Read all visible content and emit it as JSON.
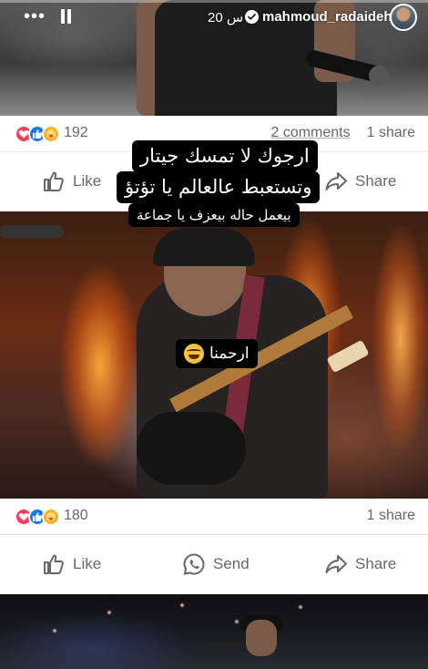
{
  "story": {
    "username": "mahmoud_radaideh",
    "time": "20 س",
    "menu_icon": "more-dots-icon",
    "pause_icon": "pause-icon",
    "verified_icon": "verified-badge-icon",
    "captions": {
      "line1": "ارجوك لا تمسك جيتار",
      "line2": "وتستعبط عالعالم يا تؤتؤ",
      "line3": "بيعمل حاله بيعزف يا جماعة",
      "reaction": "ارحمنا",
      "reaction_emoji": "laughing-tears-emoji"
    }
  },
  "post1": {
    "reaction_icons": [
      "love-reaction-icon",
      "like-reaction-icon",
      "care-reaction-icon"
    ],
    "reaction_count": "192",
    "comments": "2 comments",
    "shares": "1 share",
    "actions": {
      "like": "Like",
      "share": "Share"
    }
  },
  "post2": {
    "reaction_icons": [
      "love-reaction-icon",
      "like-reaction-icon",
      "care-reaction-icon"
    ],
    "reaction_count": "180",
    "shares": "1 share",
    "actions": {
      "like": "Like",
      "send": "Send",
      "share": "Share"
    }
  },
  "colors": {
    "love": "#f33e58",
    "like": "#1877f2",
    "care": "#f7b125",
    "meta_text": "#65676b",
    "caption_bg": "#000000"
  }
}
